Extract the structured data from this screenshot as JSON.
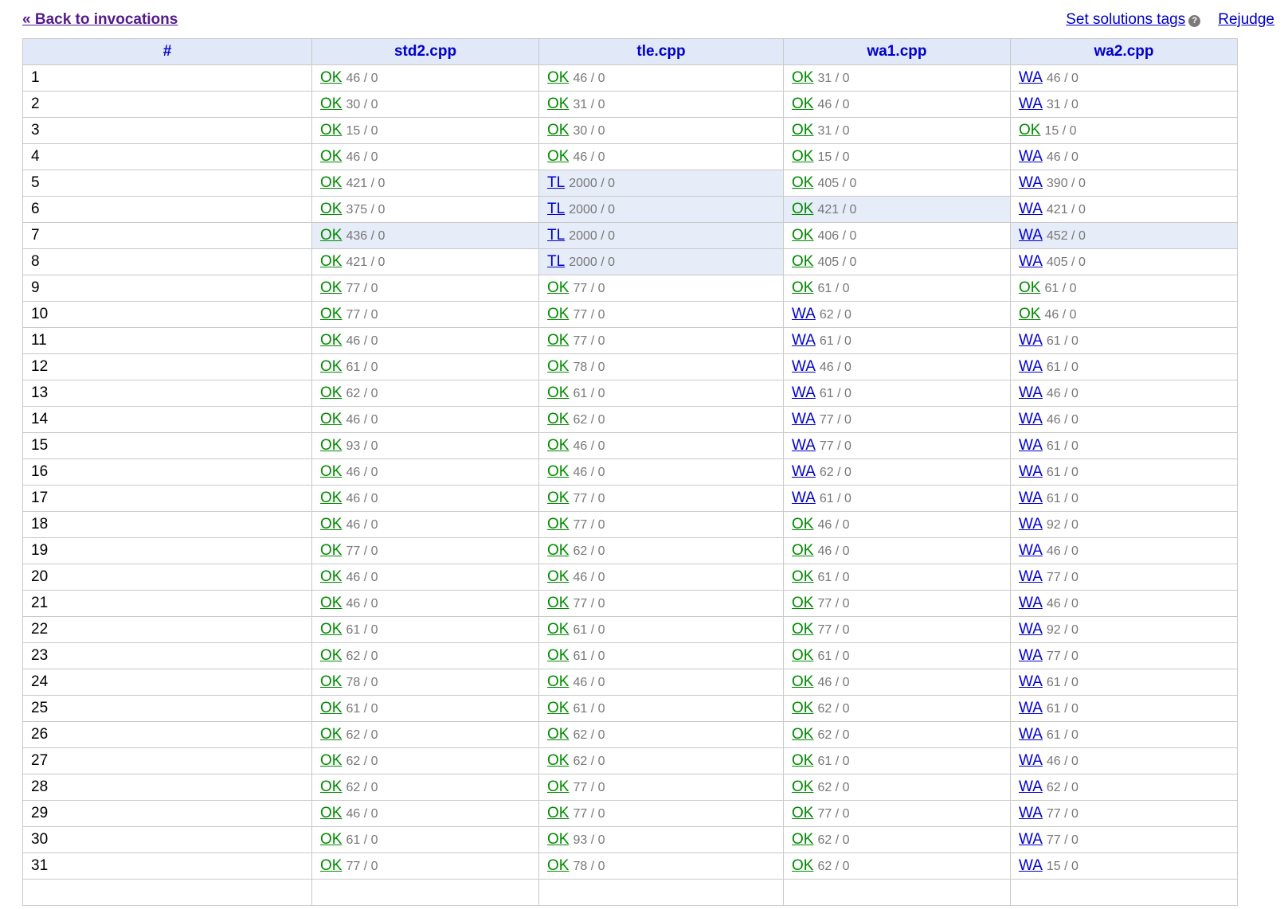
{
  "header": {
    "back_label": "« Back to invocations",
    "tags_label": "Set solutions tags",
    "rejudge_label": "Rejudge",
    "help_icon": "question-circle-icon"
  },
  "columns": [
    "#",
    "std2.cpp",
    "tle.cpp",
    "wa1.cpp",
    "wa2.cpp"
  ],
  "colors": {
    "ok": "#008a00",
    "wa": "#0000cc",
    "highlight": "#e6ecf8",
    "header_bg": "#e1e8f7"
  },
  "rows": [
    {
      "n": "1",
      "cells": [
        {
          "v": "OK",
          "m": "46 / 0"
        },
        {
          "v": "OK",
          "m": "46 / 0"
        },
        {
          "v": "OK",
          "m": "31 / 0"
        },
        {
          "v": "WA",
          "m": "46 / 0"
        }
      ]
    },
    {
      "n": "2",
      "cells": [
        {
          "v": "OK",
          "m": "30 / 0"
        },
        {
          "v": "OK",
          "m": "31 / 0"
        },
        {
          "v": "OK",
          "m": "46 / 0"
        },
        {
          "v": "WA",
          "m": "31 / 0"
        }
      ]
    },
    {
      "n": "3",
      "cells": [
        {
          "v": "OK",
          "m": "15 / 0"
        },
        {
          "v": "OK",
          "m": "30 / 0"
        },
        {
          "v": "OK",
          "m": "31 / 0"
        },
        {
          "v": "OK",
          "m": "15 / 0"
        }
      ]
    },
    {
      "n": "4",
      "cells": [
        {
          "v": "OK",
          "m": "46 / 0"
        },
        {
          "v": "OK",
          "m": "46 / 0"
        },
        {
          "v": "OK",
          "m": "15 / 0"
        },
        {
          "v": "WA",
          "m": "46 / 0"
        }
      ]
    },
    {
      "n": "5",
      "cells": [
        {
          "v": "OK",
          "m": "421 / 0"
        },
        {
          "v": "TL",
          "m": "2000 / 0",
          "hl": true
        },
        {
          "v": "OK",
          "m": "405 / 0"
        },
        {
          "v": "WA",
          "m": "390 / 0"
        }
      ]
    },
    {
      "n": "6",
      "cells": [
        {
          "v": "OK",
          "m": "375 / 0"
        },
        {
          "v": "TL",
          "m": "2000 / 0",
          "hl": true
        },
        {
          "v": "OK",
          "m": "421 / 0",
          "hl": true
        },
        {
          "v": "WA",
          "m": "421 / 0"
        }
      ]
    },
    {
      "n": "7",
      "cells": [
        {
          "v": "OK",
          "m": "436 / 0",
          "hl": true
        },
        {
          "v": "TL",
          "m": "2000 / 0",
          "hl": true
        },
        {
          "v": "OK",
          "m": "406 / 0"
        },
        {
          "v": "WA",
          "m": "452 / 0",
          "hl": true
        }
      ]
    },
    {
      "n": "8",
      "cells": [
        {
          "v": "OK",
          "m": "421 / 0"
        },
        {
          "v": "TL",
          "m": "2000 / 0",
          "hl": true
        },
        {
          "v": "OK",
          "m": "405 / 0"
        },
        {
          "v": "WA",
          "m": "405 / 0"
        }
      ]
    },
    {
      "n": "9",
      "cells": [
        {
          "v": "OK",
          "m": "77 / 0"
        },
        {
          "v": "OK",
          "m": "77 / 0"
        },
        {
          "v": "OK",
          "m": "61 / 0"
        },
        {
          "v": "OK",
          "m": "61 / 0"
        }
      ]
    },
    {
      "n": "10",
      "cells": [
        {
          "v": "OK",
          "m": "77 / 0"
        },
        {
          "v": "OK",
          "m": "77 / 0"
        },
        {
          "v": "WA",
          "m": "62 / 0"
        },
        {
          "v": "OK",
          "m": "46 / 0"
        }
      ]
    },
    {
      "n": "11",
      "cells": [
        {
          "v": "OK",
          "m": "46 / 0"
        },
        {
          "v": "OK",
          "m": "77 / 0"
        },
        {
          "v": "WA",
          "m": "61 / 0"
        },
        {
          "v": "WA",
          "m": "61 / 0"
        }
      ]
    },
    {
      "n": "12",
      "cells": [
        {
          "v": "OK",
          "m": "61 / 0"
        },
        {
          "v": "OK",
          "m": "78 / 0"
        },
        {
          "v": "WA",
          "m": "46 / 0"
        },
        {
          "v": "WA",
          "m": "61 / 0"
        }
      ]
    },
    {
      "n": "13",
      "cells": [
        {
          "v": "OK",
          "m": "62 / 0"
        },
        {
          "v": "OK",
          "m": "61 / 0"
        },
        {
          "v": "WA",
          "m": "61 / 0"
        },
        {
          "v": "WA",
          "m": "46 / 0"
        }
      ]
    },
    {
      "n": "14",
      "cells": [
        {
          "v": "OK",
          "m": "46 / 0"
        },
        {
          "v": "OK",
          "m": "62 / 0"
        },
        {
          "v": "WA",
          "m": "77 / 0"
        },
        {
          "v": "WA",
          "m": "46 / 0"
        }
      ]
    },
    {
      "n": "15",
      "cells": [
        {
          "v": "OK",
          "m": "93 / 0"
        },
        {
          "v": "OK",
          "m": "46 / 0"
        },
        {
          "v": "WA",
          "m": "77 / 0"
        },
        {
          "v": "WA",
          "m": "61 / 0"
        }
      ]
    },
    {
      "n": "16",
      "cells": [
        {
          "v": "OK",
          "m": "46 / 0"
        },
        {
          "v": "OK",
          "m": "46 / 0"
        },
        {
          "v": "WA",
          "m": "62 / 0"
        },
        {
          "v": "WA",
          "m": "61 / 0"
        }
      ]
    },
    {
      "n": "17",
      "cells": [
        {
          "v": "OK",
          "m": "46 / 0"
        },
        {
          "v": "OK",
          "m": "77 / 0"
        },
        {
          "v": "WA",
          "m": "61 / 0"
        },
        {
          "v": "WA",
          "m": "61 / 0"
        }
      ]
    },
    {
      "n": "18",
      "cells": [
        {
          "v": "OK",
          "m": "46 / 0"
        },
        {
          "v": "OK",
          "m": "77 / 0"
        },
        {
          "v": "OK",
          "m": "46 / 0"
        },
        {
          "v": "WA",
          "m": "92 / 0"
        }
      ]
    },
    {
      "n": "19",
      "cells": [
        {
          "v": "OK",
          "m": "77 / 0"
        },
        {
          "v": "OK",
          "m": "62 / 0"
        },
        {
          "v": "OK",
          "m": "46 / 0"
        },
        {
          "v": "WA",
          "m": "46 / 0"
        }
      ]
    },
    {
      "n": "20",
      "cells": [
        {
          "v": "OK",
          "m": "46 / 0"
        },
        {
          "v": "OK",
          "m": "46 / 0"
        },
        {
          "v": "OK",
          "m": "61 / 0"
        },
        {
          "v": "WA",
          "m": "77 / 0"
        }
      ]
    },
    {
      "n": "21",
      "cells": [
        {
          "v": "OK",
          "m": "46 / 0"
        },
        {
          "v": "OK",
          "m": "77 / 0"
        },
        {
          "v": "OK",
          "m": "77 / 0"
        },
        {
          "v": "WA",
          "m": "46 / 0"
        }
      ]
    },
    {
      "n": "22",
      "cells": [
        {
          "v": "OK",
          "m": "61 / 0"
        },
        {
          "v": "OK",
          "m": "61 / 0"
        },
        {
          "v": "OK",
          "m": "77 / 0"
        },
        {
          "v": "WA",
          "m": "92 / 0"
        }
      ]
    },
    {
      "n": "23",
      "cells": [
        {
          "v": "OK",
          "m": "62 / 0"
        },
        {
          "v": "OK",
          "m": "61 / 0"
        },
        {
          "v": "OK",
          "m": "61 / 0"
        },
        {
          "v": "WA",
          "m": "77 / 0"
        }
      ]
    },
    {
      "n": "24",
      "cells": [
        {
          "v": "OK",
          "m": "78 / 0"
        },
        {
          "v": "OK",
          "m": "46 / 0"
        },
        {
          "v": "OK",
          "m": "46 / 0"
        },
        {
          "v": "WA",
          "m": "61 / 0"
        }
      ]
    },
    {
      "n": "25",
      "cells": [
        {
          "v": "OK",
          "m": "61 / 0"
        },
        {
          "v": "OK",
          "m": "61 / 0"
        },
        {
          "v": "OK",
          "m": "62 / 0"
        },
        {
          "v": "WA",
          "m": "61 / 0"
        }
      ]
    },
    {
      "n": "26",
      "cells": [
        {
          "v": "OK",
          "m": "62 / 0"
        },
        {
          "v": "OK",
          "m": "62 / 0"
        },
        {
          "v": "OK",
          "m": "62 / 0"
        },
        {
          "v": "WA",
          "m": "61 / 0"
        }
      ]
    },
    {
      "n": "27",
      "cells": [
        {
          "v": "OK",
          "m": "62 / 0"
        },
        {
          "v": "OK",
          "m": "62 / 0"
        },
        {
          "v": "OK",
          "m": "61 / 0"
        },
        {
          "v": "WA",
          "m": "46 / 0"
        }
      ]
    },
    {
      "n": "28",
      "cells": [
        {
          "v": "OK",
          "m": "62 / 0"
        },
        {
          "v": "OK",
          "m": "77 / 0"
        },
        {
          "v": "OK",
          "m": "62 / 0"
        },
        {
          "v": "WA",
          "m": "62 / 0"
        }
      ]
    },
    {
      "n": "29",
      "cells": [
        {
          "v": "OK",
          "m": "46 / 0"
        },
        {
          "v": "OK",
          "m": "77 / 0"
        },
        {
          "v": "OK",
          "m": "77 / 0"
        },
        {
          "v": "WA",
          "m": "77 / 0"
        }
      ]
    },
    {
      "n": "30",
      "cells": [
        {
          "v": "OK",
          "m": "61 / 0"
        },
        {
          "v": "OK",
          "m": "93 / 0"
        },
        {
          "v": "OK",
          "m": "62 / 0"
        },
        {
          "v": "WA",
          "m": "77 / 0"
        }
      ]
    },
    {
      "n": "31",
      "cells": [
        {
          "v": "OK",
          "m": "77 / 0"
        },
        {
          "v": "OK",
          "m": "78 / 0"
        },
        {
          "v": "OK",
          "m": "62 / 0"
        },
        {
          "v": "WA",
          "m": "15 / 0"
        }
      ]
    },
    {
      "n": "",
      "cells": [
        {
          "v": "",
          "m": ""
        },
        {
          "v": "",
          "m": ""
        },
        {
          "v": "",
          "m": ""
        },
        {
          "v": "",
          "m": ""
        }
      ]
    }
  ]
}
